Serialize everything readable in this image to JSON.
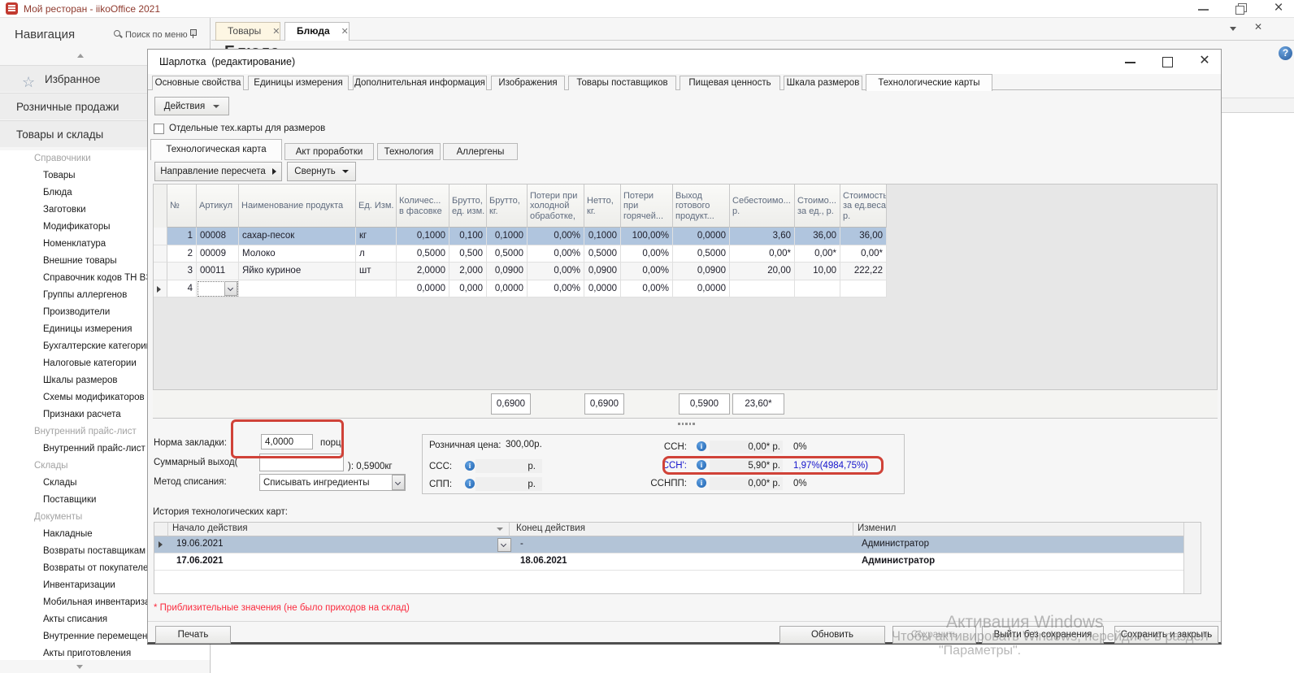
{
  "window": {
    "title": "Мой ресторан - iikoOffice 2021"
  },
  "doc_tabs": [
    {
      "label": "Товары",
      "active": false
    },
    {
      "label": "Блюда",
      "active": true
    }
  ],
  "content_heading": "Блюда",
  "nav": {
    "title": "Навигация",
    "search_label": "Поиск по меню",
    "groups": [
      {
        "label": "Избранное",
        "icon": "star"
      },
      {
        "label": "Розничные продажи"
      },
      {
        "label": "Товары и склады"
      }
    ],
    "tree": [
      {
        "label": "Справочники",
        "section": true
      },
      {
        "label": "Товары"
      },
      {
        "label": "Блюда"
      },
      {
        "label": "Заготовки"
      },
      {
        "label": "Модификаторы"
      },
      {
        "label": "Номенклатура"
      },
      {
        "label": "Внешние товары"
      },
      {
        "label": "Справочник кодов ТН ВЭД"
      },
      {
        "label": "Группы аллергенов"
      },
      {
        "label": "Производители"
      },
      {
        "label": "Единицы измерения"
      },
      {
        "label": "Бухгалтерские категории"
      },
      {
        "label": "Налоговые категории"
      },
      {
        "label": "Шкалы размеров"
      },
      {
        "label": "Схемы модификаторов"
      },
      {
        "label": "Признаки расчета"
      },
      {
        "label": "Внутренний прайс-лист",
        "section": true
      },
      {
        "label": "Внутренний прайс-лист"
      },
      {
        "label": "Склады",
        "section": true
      },
      {
        "label": "Склады"
      },
      {
        "label": "Поставщики"
      },
      {
        "label": "Документы",
        "section": true
      },
      {
        "label": "Накладные"
      },
      {
        "label": "Возвраты поставщикам"
      },
      {
        "label": "Возвраты от покупателей"
      },
      {
        "label": "Инвентаризации"
      },
      {
        "label": "Мобильная инвентаризац"
      },
      {
        "label": "Акты списания"
      },
      {
        "label": "Внутренние перемещения"
      },
      {
        "label": "Акты приготовления"
      }
    ]
  },
  "dialog": {
    "title": "Шарлотка  (редактирование)",
    "tabs": [
      "Основные свойства",
      "Единицы измерения",
      "Дополнительная информация",
      "Изображения",
      "Товары поставщиков",
      "Пищевая ценность",
      "Шкала размеров",
      "Технологические карты"
    ],
    "active_tab": "Технологические карты",
    "actions_button": "Действия",
    "sizes_checkbox": {
      "label": "Отдельные тех.карты для размеров",
      "checked": false
    },
    "inner_tabs": [
      "Технологическая карта",
      "Акт проработки",
      "Технология",
      "Аллергены"
    ],
    "active_inner_tab": "Технологическая карта",
    "recalc_button": "Направление пересчета",
    "collapse_button": "Свернуть",
    "grid": {
      "columns": [
        "№",
        "Артикул",
        "Наименование продукта",
        "Ед. Изм.",
        "Количес...\nв фасовке",
        "Брутто,\nед. изм.",
        "Брутто,\nкг.",
        "Потери при\nхолодной\nобработке,",
        "Нетто,\nкг.",
        "Потери\nпри\nгорячей...",
        "Выход\nготового\nпродукт...",
        "Себестоимо...\nр.",
        "Стоимо...\nза ед., р.",
        "Стоимость\nза ед.веса,\nр."
      ],
      "rows": [
        {
          "num": "1",
          "article": "00008",
          "name": "сахар-песок",
          "unit": "кг",
          "qty": "0,1000",
          "gross_unit": "0,100",
          "gross_kg": "0,1000",
          "cold_loss": "0,00%",
          "net_kg": "0,1000",
          "hot_loss": "100,00%",
          "yield": "0,0000",
          "cost": "3,60",
          "cost_per_unit": "36,00",
          "cost_per_weight": "36,00",
          "selected": true
        },
        {
          "num": "2",
          "article": "00009",
          "name": "Молоко",
          "unit": "л",
          "qty": "0,5000",
          "gross_unit": "0,500",
          "gross_kg": "0,5000",
          "cold_loss": "0,00%",
          "net_kg": "0,5000",
          "hot_loss": "0,00%",
          "yield": "0,5000",
          "cost": "0,00*",
          "cost_per_unit": "0,00*",
          "cost_per_weight": "0,00*"
        },
        {
          "num": "3",
          "article": "00011",
          "name": "Яйко куриное",
          "unit": "шт",
          "qty": "2,0000",
          "gross_unit": "2,000",
          "gross_kg": "0,0900",
          "cold_loss": "0,00%",
          "net_kg": "0,0900",
          "hot_loss": "0,00%",
          "yield": "0,0900",
          "cost": "20,00",
          "cost_per_unit": "10,00",
          "cost_per_weight": "222,22"
        },
        {
          "num": "4",
          "article": "",
          "name": "",
          "unit": "",
          "qty": "0,0000",
          "gross_unit": "0,000",
          "gross_kg": "0,0000",
          "cold_loss": "0,00%",
          "net_kg": "0,0000",
          "hot_loss": "0,00%",
          "yield": "0,0000",
          "cost": "",
          "cost_per_unit": "",
          "cost_per_weight": "",
          "editing": true
        }
      ],
      "totals": {
        "gross_kg": "0,6900",
        "net_kg": "0,6900",
        "yield": "0,5900",
        "cost": "23,60*"
      }
    },
    "form": {
      "portion_label": "Норма закладки:",
      "portion_value": "4,0000",
      "portion_unit": "порц",
      "total_yield_label": "Суммарный выход(",
      "total_yield_value": "",
      "total_yield_suffix": "): 0,5900кг",
      "writeoff_label": "Метод списания:",
      "writeoff_value": "Списывать ингредиенты"
    },
    "costs": {
      "retail_label": "Розничная цена:",
      "retail_value": "300,00р.",
      "left_rows": [
        {
          "label": "ССС:",
          "value": "",
          "unit": "р."
        },
        {
          "label": "СПП:",
          "value": "",
          "unit": "р."
        }
      ],
      "right_rows": [
        {
          "label": "ССН:",
          "value": "0,00* р.",
          "percent": "0%"
        },
        {
          "label": "ССН':",
          "value": "5,90* р.",
          "percent": "1,97%(4984,75%)",
          "highlight": true
        },
        {
          "label": "ССНПП:",
          "value": "0,00* р.",
          "percent": "0%"
        }
      ]
    },
    "history": {
      "label": "История технологических карт:",
      "columns": [
        "Начало действия",
        "Конец действия",
        "Изменил"
      ],
      "rows": [
        {
          "start": "19.06.2021",
          "end": "-",
          "user": "Администратор",
          "selected": true
        },
        {
          "start": "17.06.2021",
          "end": "18.06.2021",
          "user": "Администратор",
          "bold": true
        }
      ]
    },
    "note": "* Приблизительные значения (не было приходов на склад)",
    "footer": {
      "print": "Печать",
      "refresh": "Обновить",
      "save": "Сохранить",
      "exit": "Выйти без сохранения",
      "save_close": "Сохранить и закрыть"
    }
  },
  "watermark": {
    "line1": "Активация Windows",
    "line2": "Чтобы активировать Windows, перейдите в раздел",
    "line3": "\"Параметры\"."
  }
}
